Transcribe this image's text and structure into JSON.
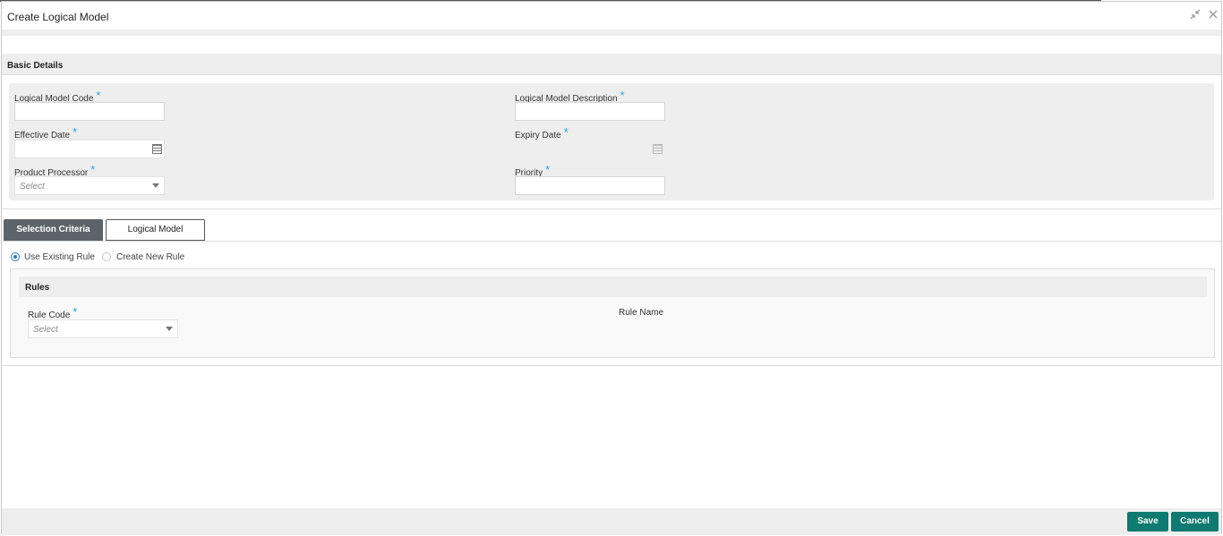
{
  "window": {
    "title": "Create Logical Model",
    "restore_icon": "restore-icon",
    "close_icon": "close-icon"
  },
  "basic_details": {
    "header": "Basic Details",
    "logical_model_code": {
      "label": "Logical Model Code",
      "required": "*",
      "value": ""
    },
    "logical_model_description": {
      "label": "Logical Model Description",
      "required": "*",
      "value": ""
    },
    "effective_date": {
      "label": "Effective Date",
      "required": "*",
      "value": ""
    },
    "expiry_date": {
      "label": "Expiry Date",
      "required": "*",
      "value": ""
    },
    "product_processor": {
      "label": "Product Processor",
      "required": "*",
      "placeholder": "Select"
    },
    "priority": {
      "label": "Priority",
      "required": "*",
      "value": ""
    }
  },
  "tabs": [
    {
      "label": "Selection Criteria",
      "active": true
    },
    {
      "label": "Logical Model",
      "active": false
    }
  ],
  "rule_options": [
    {
      "label": "Use Existing Rule",
      "selected": true
    },
    {
      "label": "Create New Rule",
      "selected": false
    }
  ],
  "rules": {
    "header": "Rules",
    "rule_code": {
      "label": "Rule Code",
      "required": "*",
      "placeholder": "Select"
    },
    "rule_name": {
      "label": "Rule Name"
    }
  },
  "footer": {
    "save_label": "Save",
    "cancel_label": "Cancel"
  },
  "colors": {
    "accent": "#0f7a70",
    "required": "#2fa3d9",
    "active_tab": "#5c6369",
    "radio": "#2a7ab5"
  }
}
